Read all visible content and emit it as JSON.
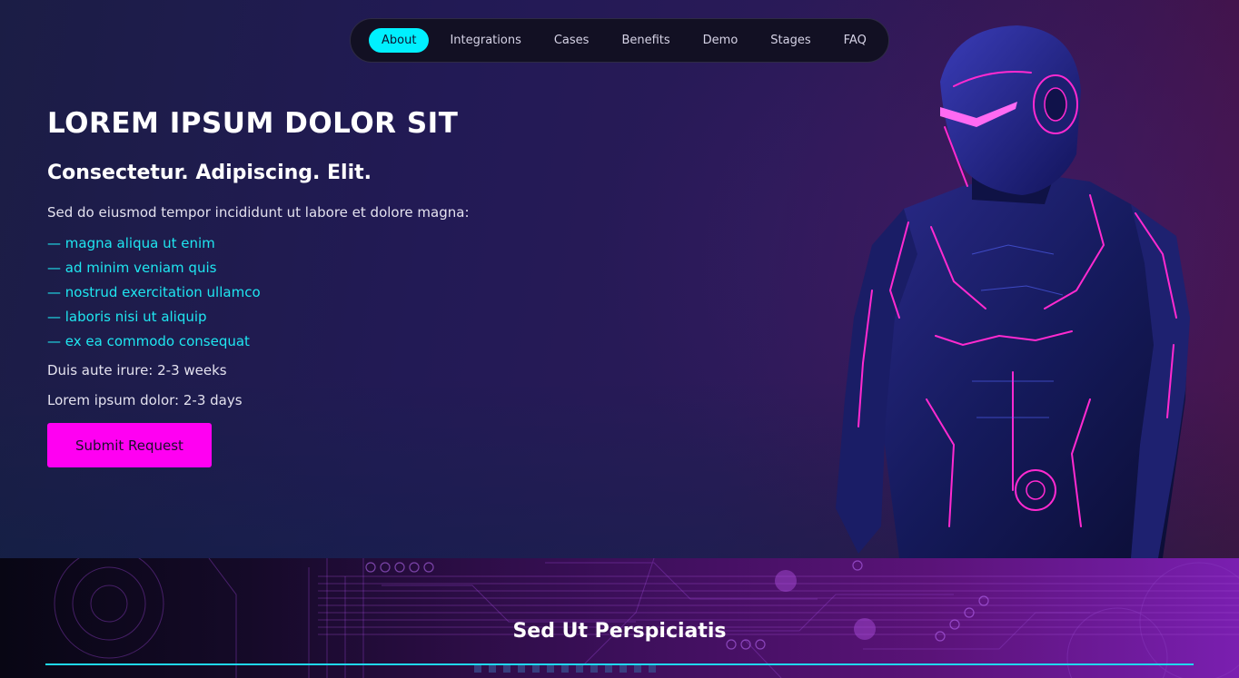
{
  "nav": {
    "items": [
      {
        "label": "About",
        "active": true
      },
      {
        "label": "Integrations",
        "active": false
      },
      {
        "label": "Cases",
        "active": false
      },
      {
        "label": "Benefits",
        "active": false
      },
      {
        "label": "Demo",
        "active": false
      },
      {
        "label": "Stages",
        "active": false
      },
      {
        "label": "FAQ",
        "active": false
      }
    ]
  },
  "hero": {
    "title": "LOREM IPSUM DOLOR SIT",
    "subtitle": "Consectetur. Adipiscing. Elit.",
    "intro": "Sed do eiusmod tempor incididunt ut labore et dolore magna:",
    "features": [
      "— magna aliqua ut enim",
      "— ad minim veniam quis",
      "— nostrud exercitation ullamco",
      "— laboris nisi ut aliquip",
      "— ex ea commodo consequat"
    ],
    "meta_1": "Duis aute irure: 2-3 weeks",
    "meta_2": "Lorem ipsum dolor: 2-3 days",
    "cta_label": "Submit Request",
    "image_icon": "cyber-robot-illustration"
  },
  "section": {
    "title": "Sed Ut Perspiciatis"
  },
  "colors": {
    "accent_cyan": "#00f0ff",
    "accent_magenta": "#ff00f2",
    "nav_bg": "#121023"
  }
}
